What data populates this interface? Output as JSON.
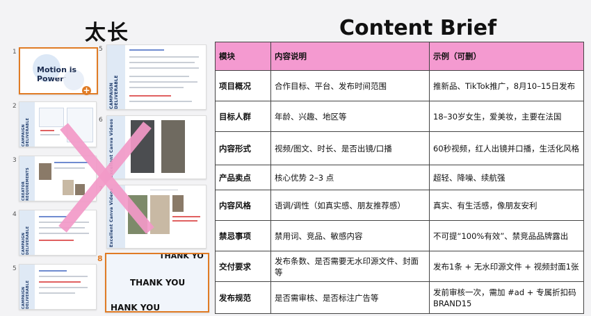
{
  "headings": {
    "left": "太长",
    "right": "Content Brief"
  },
  "slides": {
    "numbers": [
      "1",
      "2",
      "3",
      "4",
      "5",
      "5",
      "6",
      "7",
      "8"
    ],
    "title_slide": {
      "title": "Motion is Power"
    },
    "side_labels": {
      "campaign": "CAMPAIGN DELIVERABLE",
      "creator": "CREATOR REQUIREMENTS",
      "excellent": "Excellent Canva Videos"
    },
    "thank_you": "THANK YOU",
    "thank_you_cut_top": "THANK YO",
    "thank_you_cut_bottom": "HANK YOU",
    "add_icon": "+"
  },
  "table": {
    "headers": [
      "模块",
      "内容说明",
      "示例（可删）"
    ],
    "rows": [
      [
        "项目概况",
        "合作目标、平台、发布时间范围",
        "推新品、TikTok推广，8月10–15日发布"
      ],
      [
        "目标人群",
        "年龄、兴趣、地区等",
        "18–30岁女生，爱美妆，主要在法国"
      ],
      [
        "内容形式",
        "视频/图文、时长、是否出镜/口播",
        "60秒视频，红人出镜并口播，生活化风格"
      ],
      [
        "产品卖点",
        "核心优势 2–3 点",
        "超轻、降噪、续航强"
      ],
      [
        "内容风格",
        "语调/调性（如真实感、朋友推荐感）",
        "真实、有生活感，像朋友安利"
      ],
      [
        "禁忌事项",
        "禁用词、竞品、敏感内容",
        "不可提“100%有效”、禁竞品品牌露出"
      ],
      [
        "交付要求",
        "发布条数、是否需要无水印源文件、封面等",
        "发布1条 + 无水印源文件 + 视频封面1张"
      ],
      [
        "发布规范",
        "是否需审核、是否标注广告等",
        "发前审核一次，需加 #ad + 专属折扣码BRAND15"
      ]
    ]
  },
  "colors": {
    "header_pink": "#f49ad0",
    "cross_pink": "#f39ac8",
    "accent_orange": "#e07b24"
  }
}
